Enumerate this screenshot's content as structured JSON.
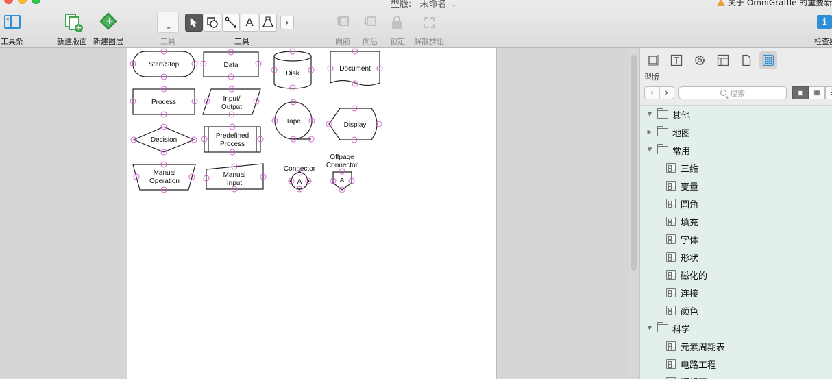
{
  "window": {
    "title_prefix": "型版:",
    "title": "未命名",
    "news": "关于 OmniGraffle 的重要新闻"
  },
  "toolbar": {
    "sidebar_label": "工具条",
    "new_canvas_label": "新建版面",
    "new_layer_label": "新建图层",
    "style_label": "工具",
    "tools_label": "工具",
    "text_tool_glyph": "A",
    "forward_label": "向前",
    "backward_label": "向后",
    "lock_label": "锁定",
    "ungroup_label": "解散群组",
    "inspect_label": "检查器",
    "inspect_glyph": "i"
  },
  "shapes": {
    "start_stop": "Start/Stop",
    "data": "Data",
    "disk": "Disk",
    "document": "Document",
    "process": "Process",
    "input_output_1": "Input/",
    "input_output_2": "Output",
    "tape": "Tape",
    "display": "Display",
    "decision": "Decision",
    "predefined_1": "Predefined",
    "predefined_2": "Process",
    "manual_op_1": "Manual",
    "manual_op_2": "Operation",
    "manual_input_1": "Manual",
    "manual_input_2": "Input",
    "connector": "Connector",
    "connector_letter": "A",
    "offpage_1": "Offpage",
    "offpage_2": "Connector",
    "offpage_letter": "A"
  },
  "inspector": {
    "section_title": "型版",
    "search_placeholder": "搜索",
    "nav_back": "‹",
    "nav_forward": "›",
    "tree": [
      {
        "label": "其他",
        "kind": "folder",
        "expanded": true,
        "indent": 0
      },
      {
        "label": "地图",
        "kind": "folder",
        "expanded": false,
        "indent": 0
      },
      {
        "label": "常用",
        "kind": "folder",
        "expanded": true,
        "indent": 0
      },
      {
        "label": "三维",
        "kind": "stencil",
        "indent": 1
      },
      {
        "label": "变量",
        "kind": "stencil",
        "indent": 1
      },
      {
        "label": "圆角",
        "kind": "stencil",
        "indent": 1
      },
      {
        "label": "填充",
        "kind": "stencil",
        "indent": 1
      },
      {
        "label": "字体",
        "kind": "stencil",
        "indent": 1
      },
      {
        "label": "形状",
        "kind": "stencil",
        "indent": 1
      },
      {
        "label": "磁化的",
        "kind": "stencil",
        "indent": 1
      },
      {
        "label": "连接",
        "kind": "stencil",
        "indent": 1
      },
      {
        "label": "颜色",
        "kind": "stencil",
        "indent": 1
      },
      {
        "label": "科学",
        "kind": "folder",
        "expanded": true,
        "indent": 0
      },
      {
        "label": "元素周期表",
        "kind": "stencil",
        "indent": 1
      },
      {
        "label": "电路工程",
        "kind": "stencil",
        "indent": 1
      },
      {
        "label": "逻辑图",
        "kind": "stencil",
        "indent": 1
      }
    ]
  },
  "colors": {
    "accent": "#2d8fd5",
    "magnet": "#d55fd0",
    "tree_bg": "#e3efea"
  }
}
